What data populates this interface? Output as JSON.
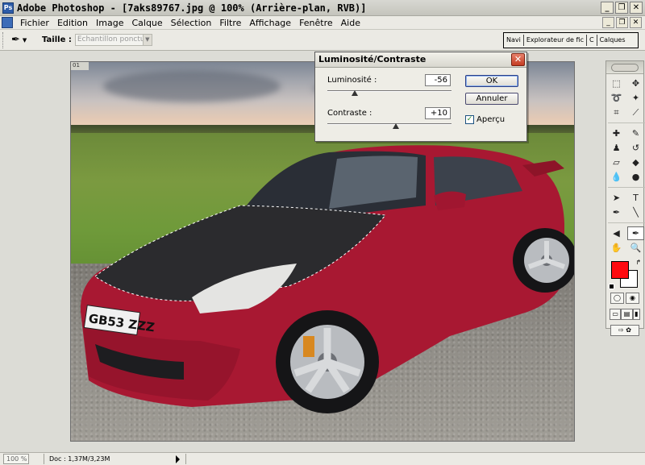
{
  "window": {
    "title": "Adobe Photoshop - [7aks89767.jpg @ 100% (Arrière-plan, RVB)]",
    "app_icon": "photoshop-icon",
    "controls": [
      "minimize-icon",
      "restore-icon",
      "close-icon"
    ]
  },
  "menu": {
    "items": [
      "Fichier",
      "Edition",
      "Image",
      "Calque",
      "Sélection",
      "Filtre",
      "Affichage",
      "Fenêtre",
      "Aide"
    ]
  },
  "options_bar": {
    "tool_icon": "eyedropper-icon",
    "size_label": "Taille :",
    "size_value": "Echantillon ponctuel",
    "palette_tabs": [
      "Navi",
      "Explorateur de fic",
      "C",
      "Calques"
    ]
  },
  "document": {
    "corner_label": "01"
  },
  "dialog": {
    "title": "Luminosité/Contraste",
    "brightness_label": "Luminosité :",
    "brightness_value": "-56",
    "brightness_slider": -56,
    "contrast_label": "Contraste :",
    "contrast_value": "+10",
    "contrast_slider": 10,
    "ok_label": "OK",
    "cancel_label": "Annuler",
    "preview_label": "Aperçu",
    "preview_checked": true
  },
  "toolbox": {
    "foreground_color": "#ff0a10",
    "background_color": "#ffffff"
  },
  "status": {
    "zoom": "100 %",
    "doc_info": "Doc : 1,37M/3,23M"
  }
}
